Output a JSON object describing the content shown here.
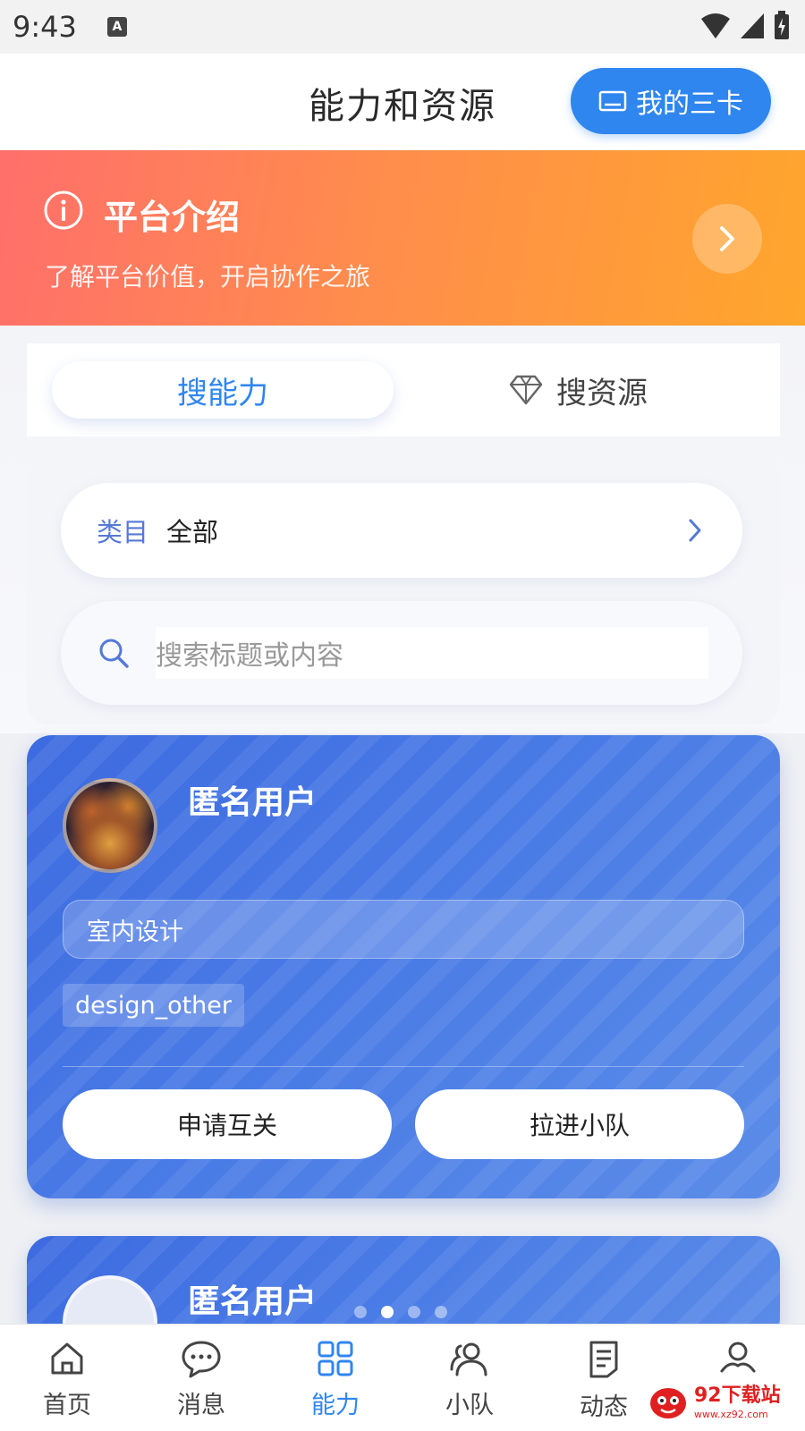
{
  "status_bar": {
    "time": "9:43",
    "notification_badge": "A"
  },
  "header": {
    "title": "能力和资源",
    "my_cards_label": "我的三卡"
  },
  "banner": {
    "title": "平台介绍",
    "subtitle": "了解平台价值，开启协作之旅"
  },
  "tabs": {
    "active_label": "搜能力",
    "inactive_label": "搜资源"
  },
  "filter": {
    "category_label": "类目",
    "category_value": "全部",
    "search_placeholder": "搜索标题或内容"
  },
  "cards": [
    {
      "name": "匿名用户",
      "skill": "室内设计",
      "tag": "design_other",
      "button_left": "申请互关",
      "button_right": "拉进小队"
    },
    {
      "name": "匿名用户"
    }
  ],
  "pager": {
    "total": 4,
    "active_index": 1
  },
  "nav": {
    "items": [
      {
        "label": "首页",
        "icon": "home-icon"
      },
      {
        "label": "消息",
        "icon": "message-icon"
      },
      {
        "label": "能力",
        "icon": "grid-icon"
      },
      {
        "label": "小队",
        "icon": "team-icon"
      },
      {
        "label": "动态",
        "icon": "document-icon"
      },
      {
        "label": "",
        "icon": "profile-icon"
      }
    ],
    "active_index": 2
  },
  "watermark": {
    "main": "92下载站",
    "sub": "www.xz92.com"
  },
  "colors": {
    "accent": "#2f86ef",
    "banner_start": "#ff6f6b",
    "banner_end": "#ffa62c",
    "card": "#4a7ce6"
  }
}
